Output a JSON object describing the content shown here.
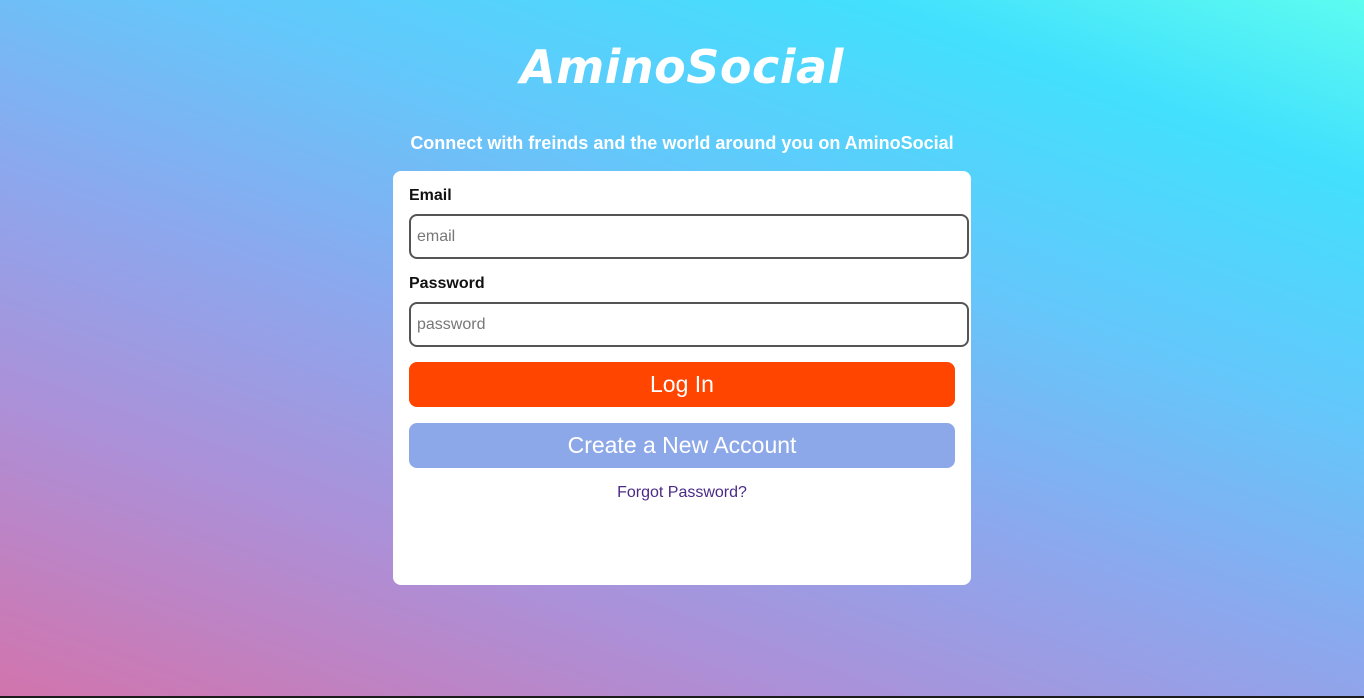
{
  "brand": {
    "title": "AminoSocial",
    "tagline": "Connect with freinds and the world around you on AminoSocial"
  },
  "login_form": {
    "email_label": "Email",
    "email_placeholder": "email",
    "email_value": "",
    "password_label": "Password",
    "password_placeholder": "password",
    "password_value": "",
    "login_button_label": "Log In",
    "create_account_button_label": "Create a New Account",
    "forgot_password_label": "Forgot Password?"
  },
  "colors": {
    "login_button": "#ff4500",
    "create_account_button": "#8da8e8",
    "forgot_link": "#4b2a86",
    "card_background": "#ffffff",
    "text_on_background": "#ffffff"
  }
}
